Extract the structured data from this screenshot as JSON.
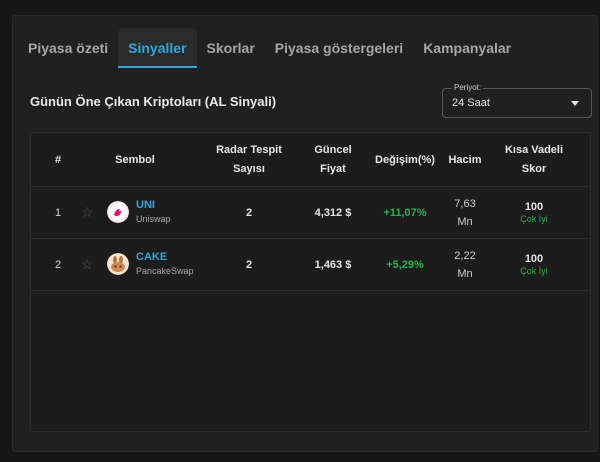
{
  "tabs": [
    {
      "label": "Piyasa özeti",
      "active": false
    },
    {
      "label": "Sinyaller",
      "active": true
    },
    {
      "label": "Skorlar",
      "active": false
    },
    {
      "label": "Piyasa göstergeleri",
      "active": false
    },
    {
      "label": "Kampanyalar",
      "active": false
    }
  ],
  "section_title": "Günün Öne Çıkan Kriptoları (AL Sinyali)",
  "period": {
    "label": "Periyot",
    "value": "24 Saat"
  },
  "table": {
    "headers": {
      "num": "#",
      "symbol": "Sembol",
      "radar_l1": "Radar Tespit",
      "radar_l2": "Sayısı",
      "price_l1": "Güncel",
      "price_l2": "Fiyat",
      "change": "Değişim(%)",
      "volume": "Hacim",
      "score_l1": "Kısa Vadeli",
      "score_l2": "Skor"
    },
    "rows": [
      {
        "num": "1",
        "symbol": "UNI",
        "name": "Uniswap",
        "radar": "2",
        "price": "4,312 $",
        "change": "+11,07%",
        "volume_l1": "7,63",
        "volume_l2": "Mn",
        "score": "100",
        "score_label": "Çok İyi"
      },
      {
        "num": "2",
        "symbol": "CAKE",
        "name": "PancakeSwap",
        "radar": "2",
        "price": "1,463 $",
        "change": "+5,29%",
        "volume_l1": "2,22",
        "volume_l2": "Mn",
        "score": "100",
        "score_label": "Çok İyi"
      }
    ]
  },
  "colors": {
    "accent": "#2fa8de",
    "positive": "#27b34a",
    "background": "#171717",
    "panel": "#202020"
  },
  "icons": {
    "star": "star-icon",
    "dropdown": "caret-down-icon",
    "uni": "uniswap-logo",
    "cake": "pancakeswap-logo"
  }
}
